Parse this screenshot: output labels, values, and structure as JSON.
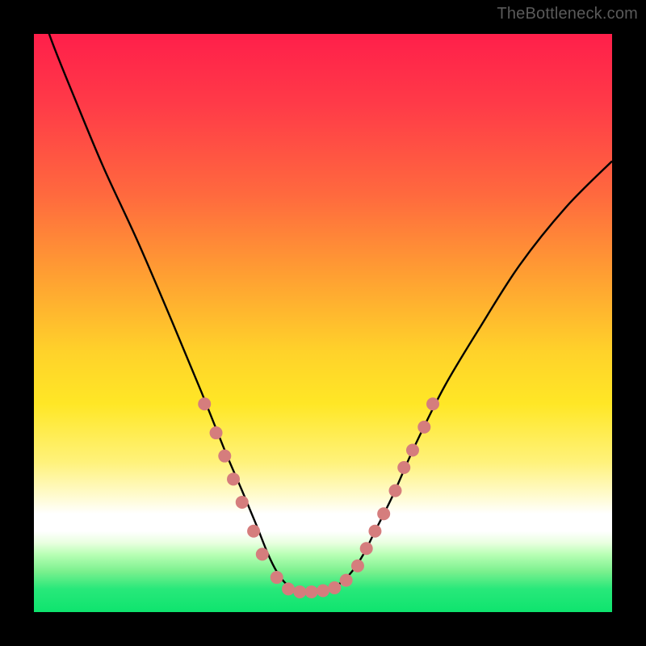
{
  "watermark": "TheBottleneck.com",
  "colors": {
    "background": "#000000",
    "curve_stroke": "#000000",
    "marker_fill": "#d57d7d",
    "gradient_top": "#ff1f4a",
    "gradient_bottom": "#0ee46e"
  },
  "chart_data": {
    "type": "line",
    "title": "",
    "xlabel": "",
    "ylabel": "",
    "xlim": [
      0,
      100
    ],
    "ylim": [
      0,
      100
    ],
    "series": [
      {
        "name": "curve",
        "x": [
          0,
          3,
          7,
          12,
          18,
          24,
          29,
          33,
          36,
          38.5,
          40.5,
          42,
          43.5,
          45,
          47,
          49,
          51,
          53,
          55,
          57,
          59,
          62,
          66,
          71,
          77,
          84,
          92,
          100
        ],
        "values": [
          108,
          99,
          89,
          77,
          64,
          50,
          38,
          28,
          21,
          15,
          10,
          7,
          5,
          4,
          3.5,
          3.5,
          4,
          5,
          7,
          10,
          14,
          20,
          29,
          39,
          49,
          60,
          70,
          78
        ]
      }
    ],
    "markers": {
      "left_cluster": [
        {
          "x": 29.5,
          "y": 36
        },
        {
          "x": 31.5,
          "y": 31
        },
        {
          "x": 33.0,
          "y": 27
        },
        {
          "x": 34.5,
          "y": 23
        },
        {
          "x": 36.0,
          "y": 19
        },
        {
          "x": 38.0,
          "y": 14
        },
        {
          "x": 39.5,
          "y": 10
        },
        {
          "x": 42.0,
          "y": 6
        }
      ],
      "bottom_cluster": [
        {
          "x": 44.0,
          "y": 4
        },
        {
          "x": 46.0,
          "y": 3.5
        },
        {
          "x": 48.0,
          "y": 3.5
        },
        {
          "x": 50.0,
          "y": 3.7
        },
        {
          "x": 52.0,
          "y": 4.2
        },
        {
          "x": 54.0,
          "y": 5.5
        }
      ],
      "right_cluster": [
        {
          "x": 56.0,
          "y": 8
        },
        {
          "x": 57.5,
          "y": 11
        },
        {
          "x": 59.0,
          "y": 14
        },
        {
          "x": 60.5,
          "y": 17
        },
        {
          "x": 62.5,
          "y": 21
        },
        {
          "x": 64.0,
          "y": 25
        },
        {
          "x": 65.5,
          "y": 28
        },
        {
          "x": 67.5,
          "y": 32
        },
        {
          "x": 69.0,
          "y": 36
        }
      ]
    }
  }
}
